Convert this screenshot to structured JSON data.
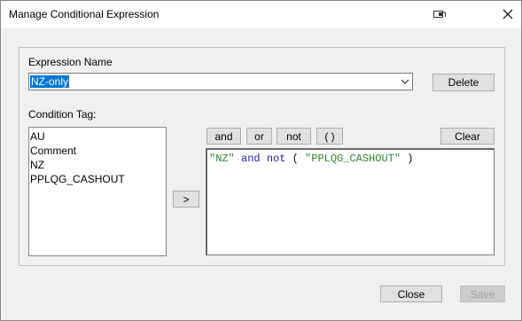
{
  "window": {
    "title": "Manage Conditional Expression"
  },
  "expression_name": {
    "label": "Expression Name",
    "value": "NZ-only",
    "delete_label": "Delete"
  },
  "condition_tag": {
    "label": "Condition Tag:",
    "items": [
      "AU",
      "Comment",
      "NZ",
      "PPLQG_CASHOUT"
    ]
  },
  "add_button": ">",
  "operators": {
    "and": "and",
    "or": "or",
    "not": "not",
    "parens": "( )",
    "clear": "Clear"
  },
  "expression": {
    "tokens": [
      {
        "text": "\"NZ\"",
        "kind": "str"
      },
      {
        "text": " ",
        "kind": "op"
      },
      {
        "text": "and",
        "kind": "kw"
      },
      {
        "text": " ",
        "kind": "op"
      },
      {
        "text": "not",
        "kind": "kw"
      },
      {
        "text": " ( ",
        "kind": "op"
      },
      {
        "text": "\"PPLQG_CASHOUT\"",
        "kind": "str"
      },
      {
        "text": " )",
        "kind": "op"
      }
    ]
  },
  "footer": {
    "close_label": "Close",
    "save_label": "Save"
  },
  "icons": {
    "restore": "restore-window-icon",
    "close": "close-icon",
    "dropdown": "chevron-down-icon"
  }
}
